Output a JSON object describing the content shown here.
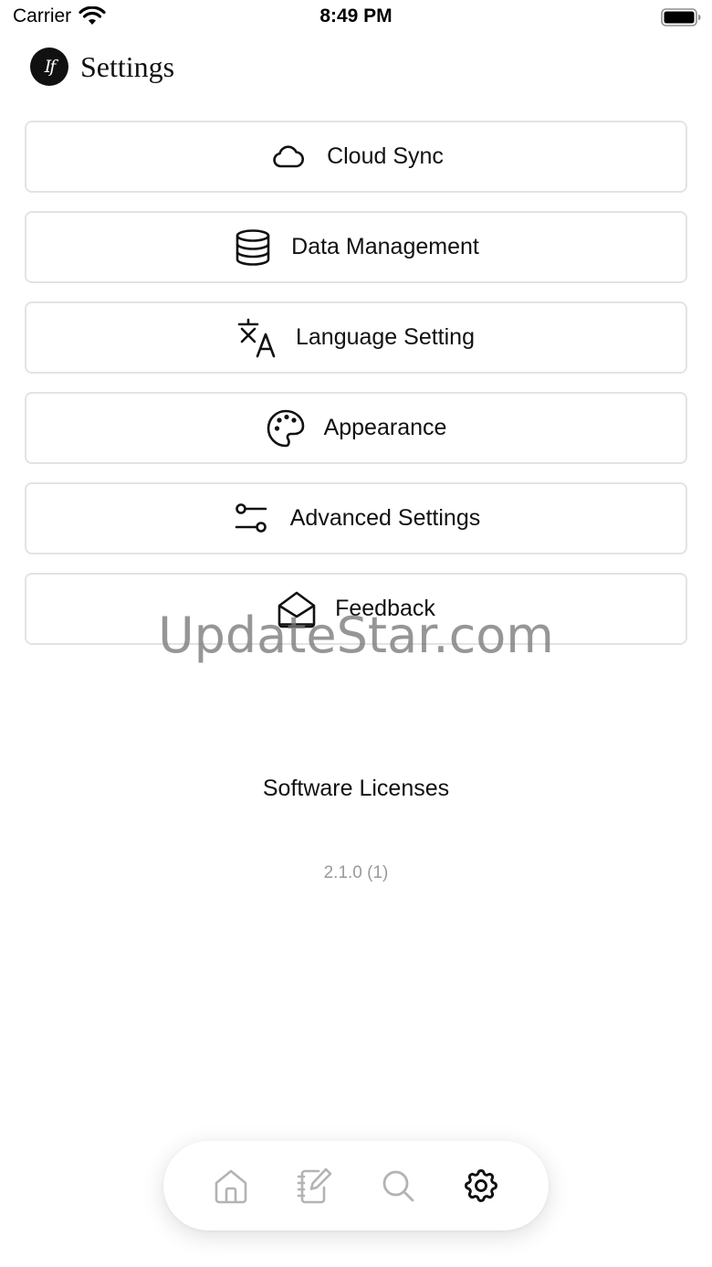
{
  "status_bar": {
    "carrier": "Carrier",
    "time": "8:49 PM",
    "icons": [
      "wifi-icon",
      "battery-icon"
    ]
  },
  "header": {
    "logo_text": "If",
    "title": "Settings"
  },
  "menu": {
    "items": [
      {
        "label": "Cloud Sync",
        "icon": "cloud-icon"
      },
      {
        "label": "Data Management",
        "icon": "database-icon"
      },
      {
        "label": "Language Setting",
        "icon": "translate-icon"
      },
      {
        "label": "Appearance",
        "icon": "palette-icon"
      },
      {
        "label": "Advanced Settings",
        "icon": "sliders-icon"
      },
      {
        "label": "Feedback",
        "icon": "envelope-open-icon"
      }
    ]
  },
  "watermark": "UpdateStar.com",
  "footer": {
    "licenses_label": "Software Licenses",
    "version": "2.1.0 (1)"
  },
  "tab_bar": {
    "tabs": [
      {
        "icon": "home-icon",
        "active": false
      },
      {
        "icon": "notebook-edit-icon",
        "active": false
      },
      {
        "icon": "search-icon",
        "active": false
      },
      {
        "icon": "gear-icon",
        "active": true
      }
    ],
    "colors": {
      "active": "#111111",
      "inactive": "#b3b3b3"
    }
  }
}
